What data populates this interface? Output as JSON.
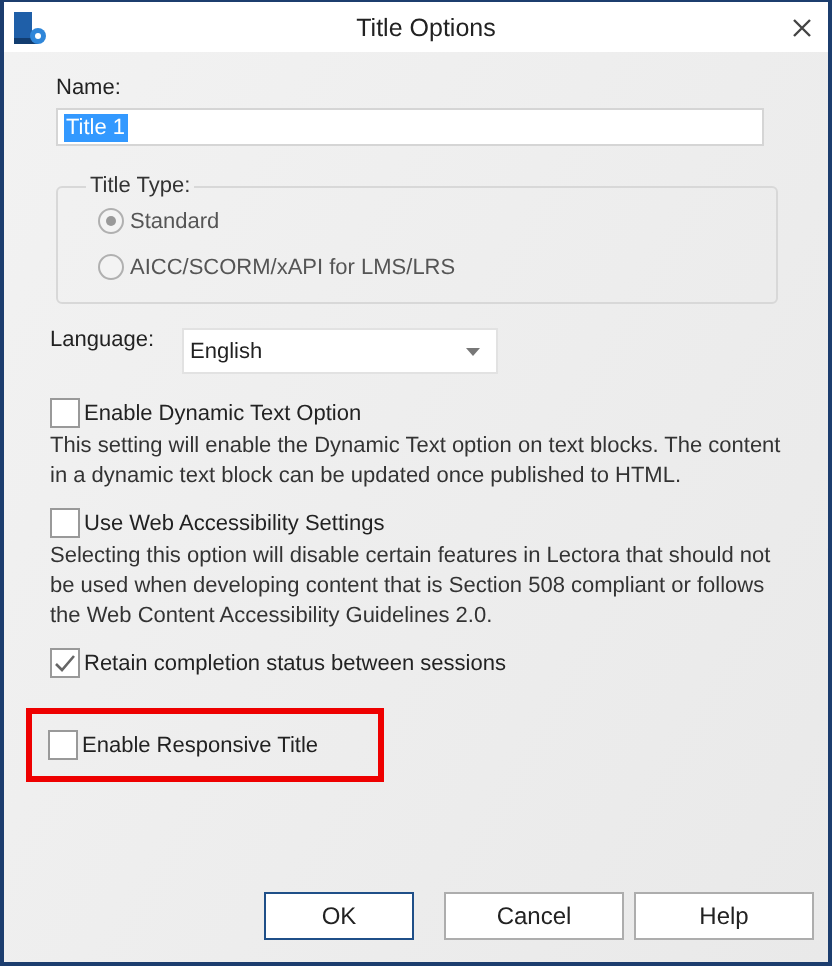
{
  "window": {
    "title": "Title Options"
  },
  "name_field": {
    "label": "Name:",
    "value": "Title 1",
    "selected_text": true
  },
  "title_type": {
    "legend": "Title Type:",
    "options": [
      {
        "label": "Standard",
        "selected": true,
        "disabled": true
      },
      {
        "label": "AICC/SCORM/xAPI for LMS/LRS",
        "selected": false,
        "disabled": true
      }
    ]
  },
  "language": {
    "label": "Language:",
    "value": "English"
  },
  "options": [
    {
      "label": "Enable Dynamic Text Option",
      "checked": false,
      "highlighted": false,
      "description": "This setting will enable the Dynamic Text option on text blocks. The content in a dynamic text block can be updated once published to HTML."
    },
    {
      "label": "Use Web Accessibility Settings",
      "checked": false,
      "highlighted": false,
      "description": "Selecting this option will disable certain features in Lectora that should not be used when developing content that is Section 508 compliant or follows the Web Content Accessibility Guidelines 2.0."
    },
    {
      "label": "Retain completion status between sessions",
      "checked": true,
      "highlighted": false
    },
    {
      "label": "Enable Responsive Title",
      "checked": false,
      "highlighted": true
    }
  ],
  "buttons": [
    {
      "label": "OK",
      "default": true
    },
    {
      "label": "Cancel",
      "default": false
    },
    {
      "label": "Help",
      "default": false
    }
  ]
}
